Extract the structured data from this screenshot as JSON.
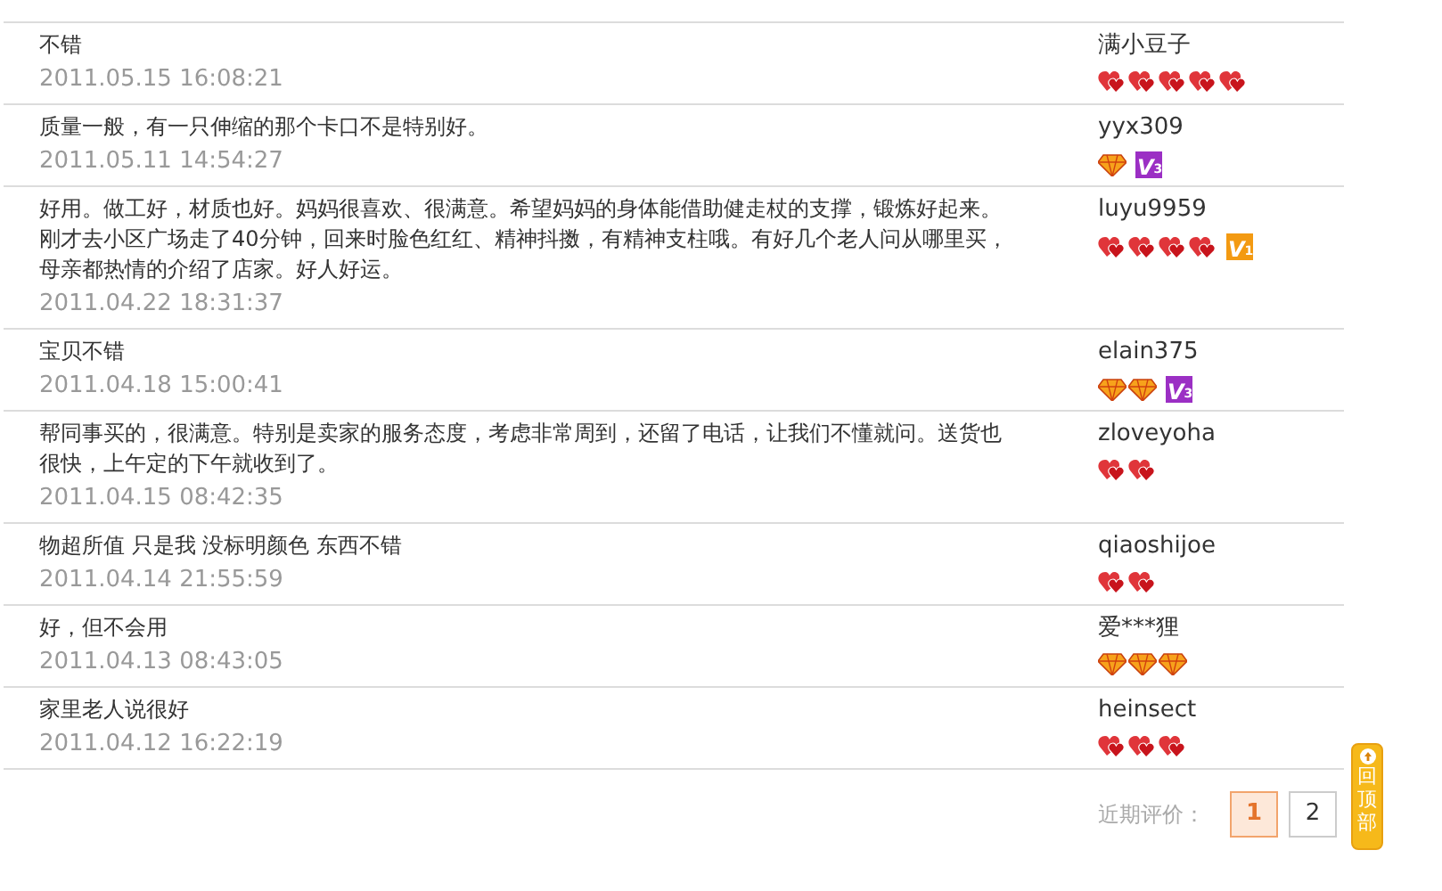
{
  "reviews": [
    {
      "comment": "不错",
      "date": "2011.05.15 16:08:21",
      "user": "满小豆子",
      "badges": [
        {
          "kind": "heart"
        },
        {
          "kind": "heart"
        },
        {
          "kind": "heart"
        },
        {
          "kind": "heart"
        },
        {
          "kind": "heart"
        }
      ]
    },
    {
      "comment": "质量一般，有一只伸缩的那个卡口不是特别好。",
      "date": "2011.05.11 14:54:27",
      "user": "yyx309",
      "badges": [
        {
          "kind": "diamond"
        },
        {
          "kind": "vip",
          "color": "#9b2fc4",
          "label": "V",
          "grade": "3"
        }
      ]
    },
    {
      "comment": "好用。做工好，材质也好。妈妈很喜欢、很满意。希望妈妈的身体能借助健走杖的支撑，锻炼好起来。刚才去小区广场走了40分钟，回来时脸色红红、精神抖擞，有精神支柱哦。有好几个老人问从哪里买，母亲都热情的介绍了店家。好人好运。",
      "date": "2011.04.22 18:31:37",
      "user": "luyu9959",
      "badges": [
        {
          "kind": "heart"
        },
        {
          "kind": "heart"
        },
        {
          "kind": "heart"
        },
        {
          "kind": "heart"
        },
        {
          "kind": "vip",
          "color": "#f39a12",
          "label": "V",
          "grade": "1"
        }
      ]
    },
    {
      "comment": "宝贝不错",
      "date": "2011.04.18 15:00:41",
      "user": "elain375",
      "badges": [
        {
          "kind": "diamond"
        },
        {
          "kind": "diamond"
        },
        {
          "kind": "vip",
          "color": "#9b2fc4",
          "label": "V",
          "grade": "3"
        }
      ]
    },
    {
      "comment": "帮同事买的，很满意。特别是卖家的服务态度，考虑非常周到，还留了电话，让我们不懂就问。送货也很快，上午定的下午就收到了。",
      "date": "2011.04.15 08:42:35",
      "user": "zloveyoha",
      "badges": [
        {
          "kind": "heart"
        },
        {
          "kind": "heart"
        }
      ]
    },
    {
      "comment": "物超所值 只是我 没标明颜色 东西不错",
      "date": "2011.04.14 21:55:59",
      "user": "qiaoshijoe",
      "badges": [
        {
          "kind": "heart"
        },
        {
          "kind": "heart"
        }
      ]
    },
    {
      "comment": "好，但不会用",
      "date": "2011.04.13 08:43:05",
      "user": "爱***狸",
      "badges": [
        {
          "kind": "diamond"
        },
        {
          "kind": "diamond"
        },
        {
          "kind": "diamond"
        }
      ]
    },
    {
      "comment": "家里老人说很好",
      "date": "2011.04.12 16:22:19",
      "user": "heinsect",
      "badges": [
        {
          "kind": "heart"
        },
        {
          "kind": "heart"
        },
        {
          "kind": "heart"
        }
      ]
    }
  ],
  "pagination": {
    "label": "近期评价：",
    "pages": [
      {
        "label": "1",
        "selected": true
      },
      {
        "label": "2",
        "selected": false
      }
    ]
  },
  "back_to_top": {
    "label": "回顶部"
  }
}
